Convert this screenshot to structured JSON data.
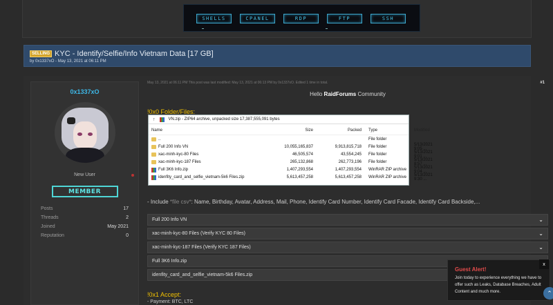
{
  "banner": {
    "buttons": [
      "SHELLS",
      "CPANEL",
      "RDP",
      "FTP",
      "SSH"
    ],
    "colors": {
      "accent": "#47c3e8"
    }
  },
  "thread": {
    "badge": "SELLING",
    "title": "KYC - Identify/Selfie/Info Vietnam Data [17 GB]",
    "meta": "by 0x1337xO - May 13, 2021 at 06:11 PM"
  },
  "user": {
    "name": "0x1337xO",
    "title": "New User",
    "rank": "MEMBER",
    "stats": [
      {
        "k": "Posts",
        "v": "17"
      },
      {
        "k": "Threads",
        "v": "2"
      },
      {
        "k": "Joined",
        "v": "May 2021"
      },
      {
        "k": "Reputation",
        "v": "0"
      }
    ]
  },
  "post": {
    "meta": "May 13, 2021 at 06:11 PM  This post was last modified: May 13, 2021 at 06:13 PM by 0x1337xO. Edited 1 time in total.",
    "number": "#1",
    "hello_prefix": "Hello",
    "hello_bold": "RaidForums",
    "hello_suffix": "Community",
    "section1": "!0x0 Folder/Files:",
    "include_prefix": "- Include",
    "include_file": "*file csv*",
    "include_suffix": ": Name, Birthday, Avatar, Address, Mail, Phone, Identify Card Number, Identify Card Facade, Identify Card Backside,...",
    "section2": "!0x1 Accept:",
    "payment": "- Payment: BTC, LTC"
  },
  "explorer": {
    "path": "VN.zip - ZIP64 archive, unpacked size 17,387,555,091 bytes",
    "headers": [
      "Name",
      "Size",
      "Packed",
      "Type",
      "Modified"
    ],
    "rows": [
      {
        "name": "..",
        "size": "",
        "packed": "",
        "type": "File folder",
        "modified": "",
        "icon": "folder-icon"
      },
      {
        "name": "Full 200 Info VN",
        "size": "10,055,165,837",
        "packed": "9,913,815,718",
        "type": "File folder",
        "modified": "5/13/2021 9:05 ...",
        "icon": "folder-icon"
      },
      {
        "name": "xac-minh-kyc-80 Files",
        "size": "46,505,574",
        "packed": "43,554,245",
        "type": "File folder",
        "modified": "5/13/2021 9:01 ...",
        "icon": "folder-icon"
      },
      {
        "name": "xac-minh-kyc-187 Files",
        "size": "265,132,868",
        "packed": "262,773,196",
        "type": "File folder",
        "modified": "5/13/2021 8:57 ...",
        "icon": "folder-icon"
      },
      {
        "name": "Full 3K6 Info.zip",
        "size": "1,407,293,554",
        "packed": "1,407,293,554",
        "type": "WinRAR ZIP archive",
        "modified": "5/13/2021 9:04 ...",
        "icon": "zip-icon"
      },
      {
        "name": "idenfity_card_and_selfie_vietnam-5k6 Files.zip",
        "size": "5,613,457,258",
        "packed": "5,613,457,258",
        "type": "WinRAR ZIP archive",
        "modified": "5/13/2021 9:30 ...",
        "icon": "zip-icon"
      }
    ]
  },
  "spoilers": [
    "Full 200 Info VN",
    "xac-minh-kyc-80 Files (Verify KYC 80 Files)",
    "xac-minh-kyc-187 Files (Verify KYC 187 Files)",
    "Full 3K6 Info.zip",
    "idenfity_card_and_selfie_vietnam-5k6 Files.zip"
  ],
  "alert": {
    "title": "Guest Alert!",
    "text": "Join today to experience everything we have to offer such as Leaks, Database Breaches, Adult Content and much more.",
    "close": "x"
  }
}
